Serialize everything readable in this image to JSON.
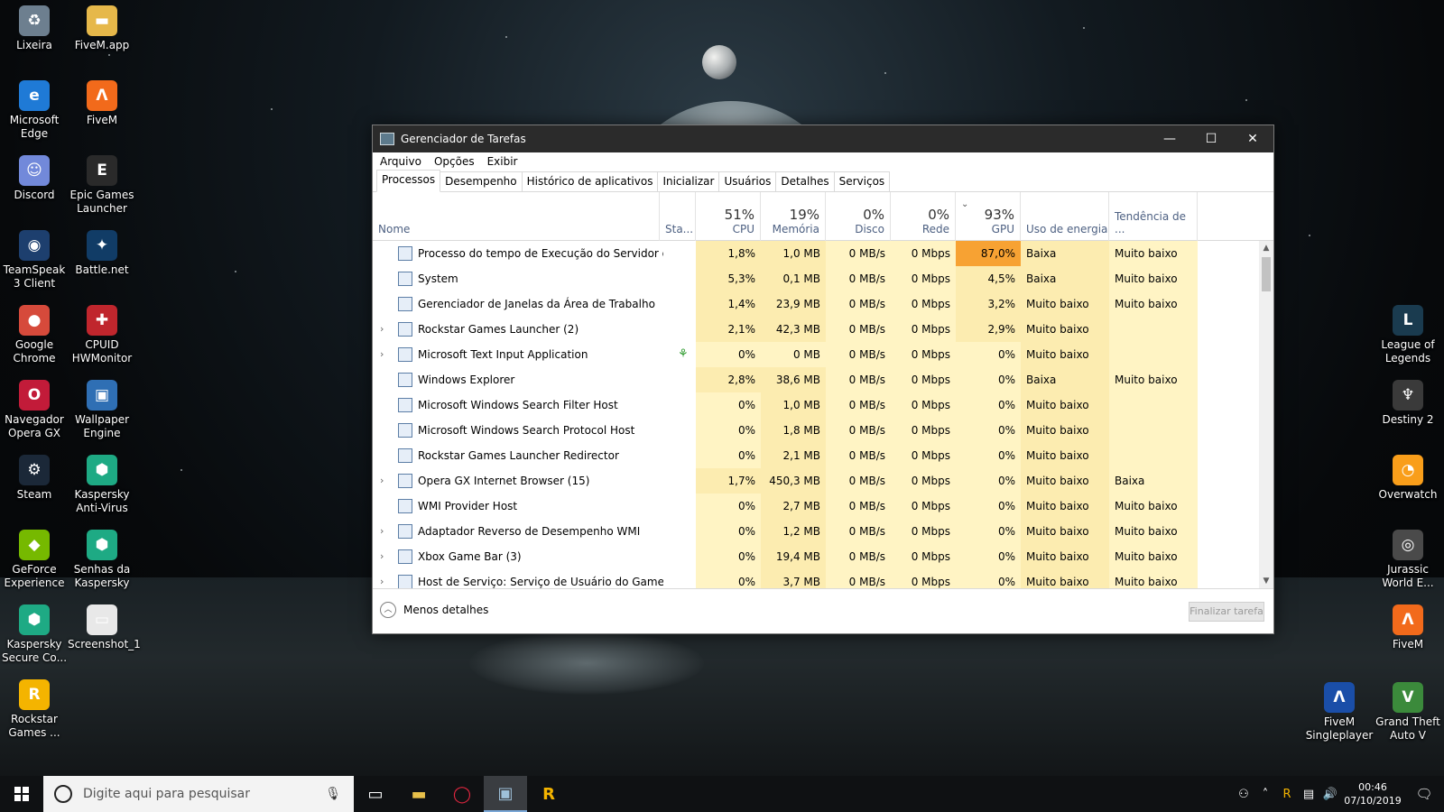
{
  "desktop_left": [
    {
      "label": "Lixeira",
      "icon": "recycle-bin-icon",
      "color": "#6d7f8f",
      "glyph": "♻"
    },
    {
      "label": "Microsoft Edge",
      "icon": "edge-icon",
      "color": "#1f7ad6",
      "glyph": "e"
    },
    {
      "label": "Discord",
      "icon": "discord-icon",
      "color": "#7289da",
      "glyph": "☺"
    },
    {
      "label": "TeamSpeak 3 Client",
      "icon": "teamspeak-icon",
      "color": "#1d3f6e",
      "glyph": "◉"
    },
    {
      "label": "Google Chrome",
      "icon": "chrome-icon",
      "color": "#d64a3b",
      "glyph": "●"
    },
    {
      "label": "Navegador Opera GX",
      "icon": "opera-gx-icon",
      "color": "#c21b39",
      "glyph": "O"
    },
    {
      "label": "Steam",
      "icon": "steam-icon",
      "color": "#1b2838",
      "glyph": "⚙"
    },
    {
      "label": "GeForce Experience",
      "icon": "geforce-icon",
      "color": "#76b900",
      "glyph": "◆"
    },
    {
      "label": "Kaspersky Secure Co...",
      "icon": "kaspersky-secure-icon",
      "color": "#1eaa84",
      "glyph": "⬢"
    },
    {
      "label": "Rockstar Games ...",
      "icon": "rockstar-icon",
      "color": "#f4b400",
      "glyph": "R"
    }
  ],
  "desktop_left2": [
    {
      "label": "FiveM.app",
      "icon": "folder-icon",
      "color": "#e6b84a",
      "glyph": "▬"
    },
    {
      "label": "FiveM",
      "icon": "fivem-icon",
      "color": "#f26a1b",
      "glyph": "Λ"
    },
    {
      "label": "Epic Games Launcher",
      "icon": "epic-games-icon",
      "color": "#2a2a2a",
      "glyph": "E"
    },
    {
      "label": "Battle.net",
      "icon": "battlenet-icon",
      "color": "#113c66",
      "glyph": "✦"
    },
    {
      "label": "CPUID HWMonitor",
      "icon": "hwmonitor-icon",
      "color": "#c0262d",
      "glyph": "✚"
    },
    {
      "label": "Wallpaper Engine",
      "icon": "wallpaper-engine-icon",
      "color": "#2f6fb4",
      "glyph": "▣"
    },
    {
      "label": "Kaspersky Anti-Virus",
      "icon": "kaspersky-icon",
      "color": "#1eaa84",
      "glyph": "⬢"
    },
    {
      "label": "Senhas da Kaspersky",
      "icon": "kaspersky-password-icon",
      "color": "#1eaa84",
      "glyph": "⬢"
    },
    {
      "label": "Screenshot_1",
      "icon": "image-file-icon",
      "color": "#e8e8e8",
      "glyph": "▭"
    }
  ],
  "desktop_right": [
    {
      "label": "League of Legends",
      "icon": "league-of-legends-icon",
      "color": "#1a3b4f",
      "glyph": "L"
    },
    {
      "label": "Destiny 2",
      "icon": "destiny-icon",
      "color": "#3a3a3a",
      "glyph": "♆"
    },
    {
      "label": "Overwatch",
      "icon": "overwatch-icon",
      "color": "#f99e1a",
      "glyph": "◔"
    },
    {
      "label": "Jurassic World E...",
      "icon": "jurassic-world-icon",
      "color": "#4a4a4a",
      "glyph": "◎"
    },
    {
      "label": "FiveM",
      "icon": "fivem-icon",
      "color": "#f26a1b",
      "glyph": "Λ"
    }
  ],
  "desktop_bottom_right": [
    {
      "label": "FiveM Singleplayer",
      "icon": "fivem-singleplayer-icon",
      "color": "#1a4ea8",
      "glyph": "Λ"
    },
    {
      "label": "Grand Theft Auto V",
      "icon": "gta-icon",
      "color": "#3b8a3b",
      "glyph": "V"
    }
  ],
  "window": {
    "title": "Gerenciador de Tarefas",
    "menu": [
      "Arquivo",
      "Opções",
      "Exibir"
    ],
    "tabs": [
      "Processos",
      "Desempenho",
      "Histórico de aplicativos",
      "Inicializar",
      "Usuários",
      "Detalhes",
      "Serviços"
    ],
    "headers": {
      "name": "Nome",
      "status": "Sta...",
      "cpu_pct": "51%",
      "cpu": "CPU",
      "mem_pct": "19%",
      "mem": "Memória",
      "disk_pct": "0%",
      "disk": "Disco",
      "net_pct": "0%",
      "net": "Rede",
      "gpu_pct": "93%",
      "gpu": "GPU",
      "power": "Uso de energia",
      "power_trend": "Tendência de ..."
    },
    "rows": [
      {
        "name": "Processo do tempo de Execução do Servidor do ...",
        "exp": "",
        "cpu": "1,8%",
        "mem": "1,0 MB",
        "disk": "0 MB/s",
        "net": "0 Mbps",
        "gpu": "87,0%",
        "power": "Baixa",
        "trend": "Muito baixo"
      },
      {
        "name": "System",
        "exp": "",
        "cpu": "5,3%",
        "mem": "0,1 MB",
        "disk": "0 MB/s",
        "net": "0 Mbps",
        "gpu": "4,5%",
        "power": "Baixa",
        "trend": "Muito baixo"
      },
      {
        "name": "Gerenciador de Janelas da Área de Trabalho",
        "exp": "",
        "cpu": "1,4%",
        "mem": "23,9 MB",
        "disk": "0 MB/s",
        "net": "0 Mbps",
        "gpu": "3,2%",
        "power": "Muito baixo",
        "trend": "Muito baixo"
      },
      {
        "name": "Rockstar Games Launcher (2)",
        "exp": "›",
        "cpu": "2,1%",
        "mem": "42,3 MB",
        "disk": "0 MB/s",
        "net": "0 Mbps",
        "gpu": "2,9%",
        "power": "Muito baixo",
        "trend": ""
      },
      {
        "name": "Microsoft Text Input Application",
        "exp": "›",
        "cpu": "0%",
        "mem": "0 MB",
        "disk": "0 MB/s",
        "net": "0 Mbps",
        "gpu": "0%",
        "power": "Muito baixo",
        "trend": ""
      },
      {
        "name": "Windows Explorer",
        "exp": "",
        "cpu": "2,8%",
        "mem": "38,6 MB",
        "disk": "0 MB/s",
        "net": "0 Mbps",
        "gpu": "0%",
        "power": "Baixa",
        "trend": "Muito baixo"
      },
      {
        "name": "Microsoft Windows Search Filter Host",
        "exp": "",
        "cpu": "0%",
        "mem": "1,0 MB",
        "disk": "0 MB/s",
        "net": "0 Mbps",
        "gpu": "0%",
        "power": "Muito baixo",
        "trend": ""
      },
      {
        "name": "Microsoft Windows Search Protocol Host",
        "exp": "",
        "cpu": "0%",
        "mem": "1,8 MB",
        "disk": "0 MB/s",
        "net": "0 Mbps",
        "gpu": "0%",
        "power": "Muito baixo",
        "trend": ""
      },
      {
        "name": "Rockstar Games Launcher Redirector",
        "exp": "",
        "cpu": "0%",
        "mem": "2,1 MB",
        "disk": "0 MB/s",
        "net": "0 Mbps",
        "gpu": "0%",
        "power": "Muito baixo",
        "trend": ""
      },
      {
        "name": "Opera GX Internet Browser (15)",
        "exp": "›",
        "cpu": "1,7%",
        "mem": "450,3 MB",
        "disk": "0 MB/s",
        "net": "0 Mbps",
        "gpu": "0%",
        "power": "Muito baixo",
        "trend": "Baixa"
      },
      {
        "name": "WMI Provider Host",
        "exp": "",
        "cpu": "0%",
        "mem": "2,7 MB",
        "disk": "0 MB/s",
        "net": "0 Mbps",
        "gpu": "0%",
        "power": "Muito baixo",
        "trend": "Muito baixo"
      },
      {
        "name": "Adaptador Reverso de Desempenho WMI",
        "exp": "›",
        "cpu": "0%",
        "mem": "1,2 MB",
        "disk": "0 MB/s",
        "net": "0 Mbps",
        "gpu": "0%",
        "power": "Muito baixo",
        "trend": "Muito baixo"
      },
      {
        "name": "Xbox Game Bar (3)",
        "exp": "›",
        "cpu": "0%",
        "mem": "19,4 MB",
        "disk": "0 MB/s",
        "net": "0 Mbps",
        "gpu": "0%",
        "power": "Muito baixo",
        "trend": "Muito baixo"
      },
      {
        "name": "Host de Serviço: Serviço de Usuário do GameDV...",
        "exp": "›",
        "cpu": "0%",
        "mem": "3,7 MB",
        "disk": "0 MB/s",
        "net": "0 Mbps",
        "gpu": "0%",
        "power": "Muito baixo",
        "trend": "Muito baixo"
      }
    ],
    "fewer_details": "Menos detalhes",
    "end_task": "Finalizar tarefa"
  },
  "taskbar": {
    "search_placeholder": "Digite aqui para pesquisar",
    "time": "00:46",
    "date": "07/10/2019"
  }
}
